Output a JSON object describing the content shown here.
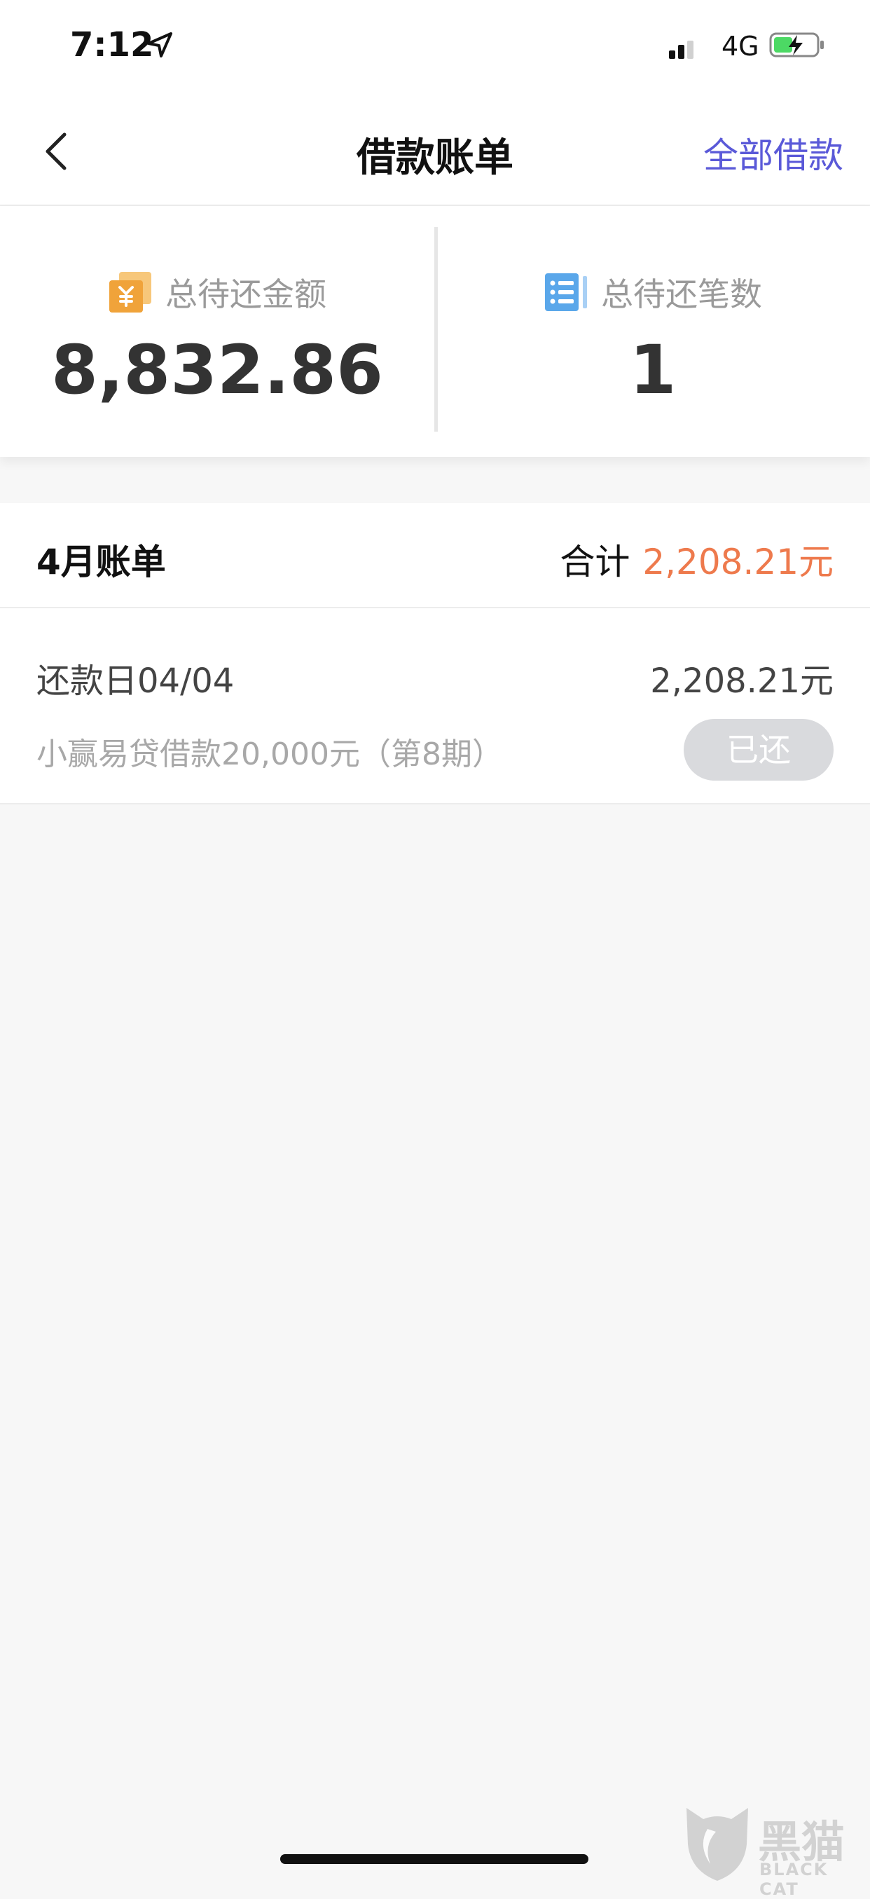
{
  "status_bar": {
    "time": "7:12",
    "network": "4G",
    "icons": [
      "location-arrow-icon",
      "signal-icon",
      "battery-charging-icon"
    ]
  },
  "nav": {
    "back_icon": "chevron-left-icon",
    "title": "借款账单",
    "action_label": "全部借款"
  },
  "summary": {
    "total_due_label": "总待还金额",
    "total_due_value": "8,832.86",
    "total_due_icon": "yuan-coins-icon",
    "count_label": "总待还笔数",
    "count_value": "1",
    "count_icon": "list-icon"
  },
  "month": {
    "title": "4月账单",
    "total_label": "合计",
    "total_amount": "2,208.21元"
  },
  "items": [
    {
      "due_date": "还款日04/04",
      "amount": "2,208.21元",
      "description": "小赢易贷借款20,000元（第8期）",
      "status": "已还"
    }
  ],
  "watermark": {
    "cn": "黑猫",
    "en": "BLACK CAT"
  },
  "colors": {
    "accent": "#5a59d8",
    "amount_highlight": "#ee7a4d",
    "coin_icon": "#f0a33a",
    "list_icon": "#5aa7ea",
    "paid_button": "#d9dadd"
  }
}
